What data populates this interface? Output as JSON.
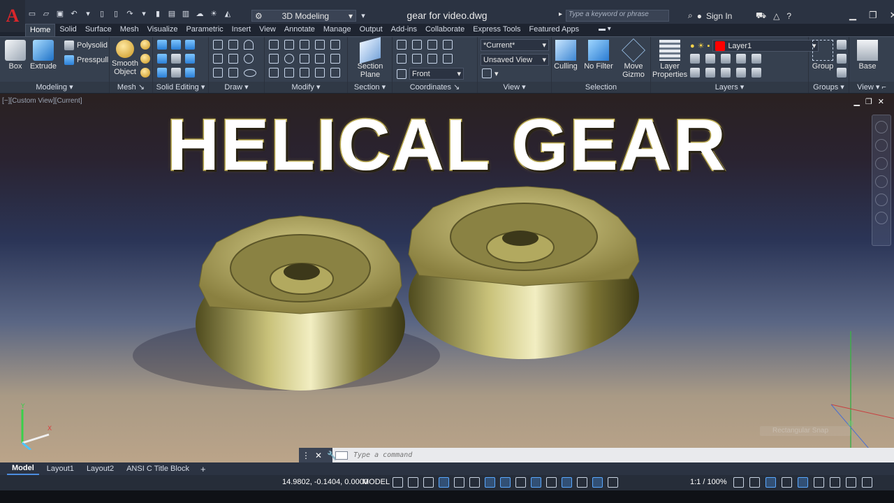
{
  "titlebar": {
    "workspace": "3D Modeling",
    "document_title": "gear for video.dwg",
    "search_placeholder": "Type a keyword or phrase",
    "sign_in": "Sign In"
  },
  "tabs": [
    "Home",
    "Solid",
    "Surface",
    "Mesh",
    "Visualize",
    "Parametric",
    "Insert",
    "View",
    "Annotate",
    "Manage",
    "Output",
    "Add-ins",
    "Collaborate",
    "Express Tools",
    "Featured Apps"
  ],
  "ribbon": {
    "modeling": {
      "title": "Modeling",
      "box": "Box",
      "extrude": "Extrude",
      "polysolid": "Polysolid",
      "presspull": "Presspull"
    },
    "mesh": {
      "title": "Mesh",
      "smooth": "Smooth",
      "object": "Object"
    },
    "solid_editing": {
      "title": "Solid Editing"
    },
    "draw": {
      "title": "Draw"
    },
    "modify": {
      "title": "Modify"
    },
    "section": {
      "title": "Section",
      "plane_line1": "Section",
      "plane_line2": "Plane"
    },
    "coordinates": {
      "title": "Coordinates",
      "ucs_value": "Front"
    },
    "view": {
      "title": "View",
      "visual_style": "*Current*",
      "saved_view": "Unsaved View"
    },
    "selection": {
      "title": "Selection",
      "culling": "Culling",
      "no_filter": "No Filter",
      "move_line1": "Move",
      "move_line2": "Gizmo"
    },
    "layers": {
      "title": "Layers",
      "props_line1": "Layer",
      "props_line2": "Properties",
      "current_layer": "Layer1",
      "layer_color": "#ff0000"
    },
    "groups": {
      "title": "Groups",
      "group": "Group"
    },
    "view2": {
      "title": "View",
      "base": "Base"
    }
  },
  "viewport": {
    "label": "[−][Custom View][Current]",
    "headline": "HELICAL GEAR",
    "tooltip": "Rectangular Snap"
  },
  "command": {
    "placeholder": "Type a command"
  },
  "layout_tabs": [
    "Model",
    "Layout1",
    "Layout2",
    "ANSI C Title Block"
  ],
  "status": {
    "coordinates": "14.9802, -0.1404, 0.0000",
    "model": "MODEL",
    "scale": "1:1 / 100%"
  }
}
